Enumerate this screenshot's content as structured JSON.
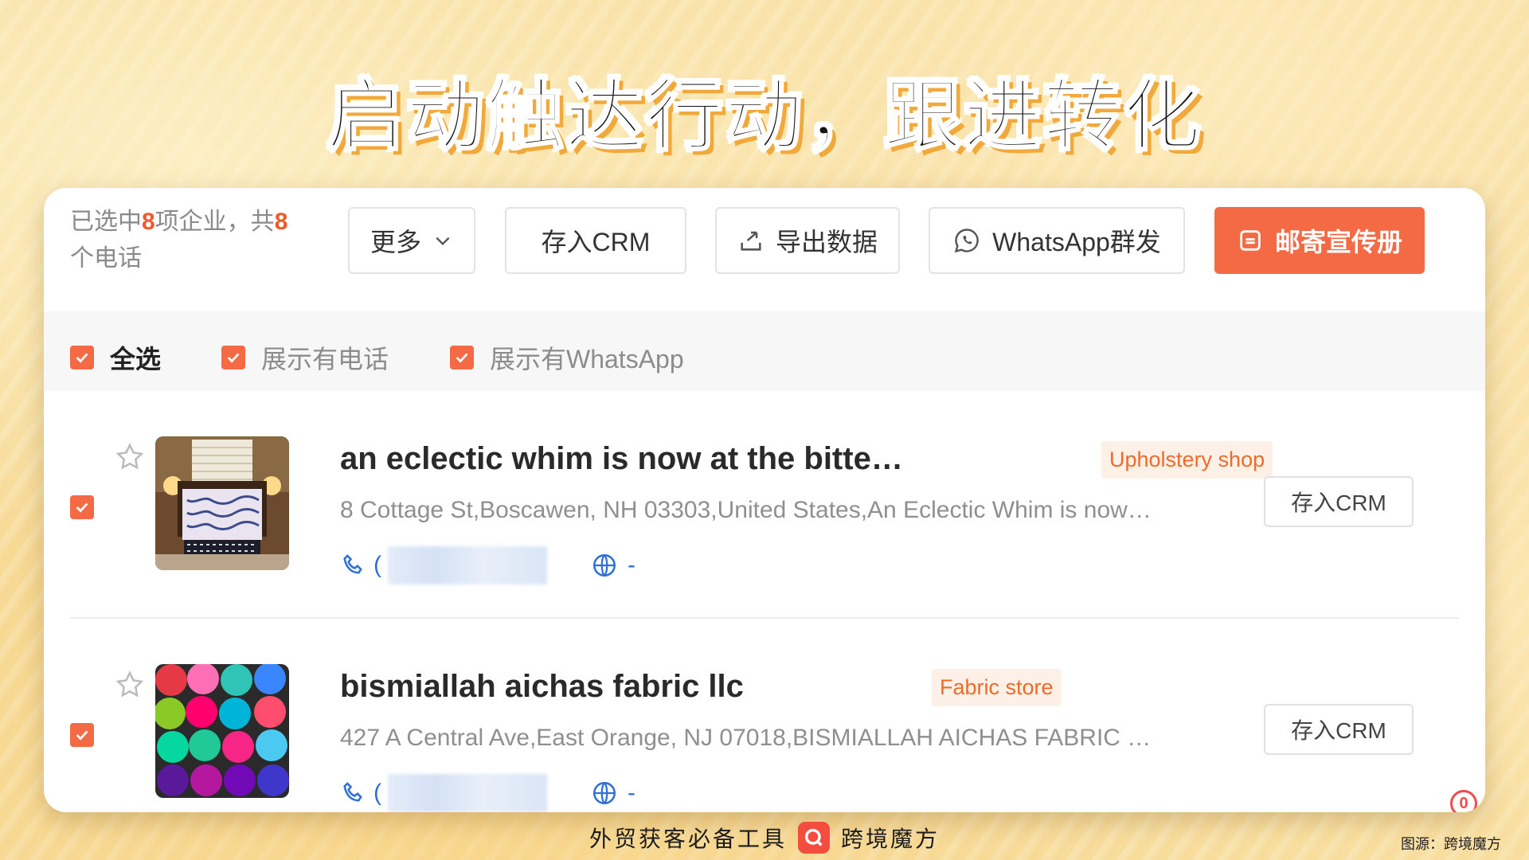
{
  "headline": "启动触达行动，跟进转化",
  "toolbar": {
    "selection_prefix": "已选中",
    "selected_count": "8",
    "selection_mid": "项企业，共",
    "phone_count": "8",
    "selection_suffix": "个电话",
    "more_label": "更多",
    "save_crm_label": "存入CRM",
    "export_label": "导出数据",
    "whatsapp_label": "WhatsApp群发",
    "mail_label": "邮寄宣传册"
  },
  "filters": {
    "select_all": "全选",
    "show_phone": "展示有电话",
    "show_whatsapp": "展示有WhatsApp"
  },
  "results": [
    {
      "name": "an eclectic whim is now at the bitte…",
      "tag": "Upholstery shop",
      "address": "8 Cottage St,Boscawen, NH 03303,United States,An Eclectic Whim is now…",
      "phone_prefix": "(",
      "website": "-",
      "crm_label": "存入CRM"
    },
    {
      "name": "bismiallah aichas fabric llc",
      "tag": "Fabric store",
      "address": "427 A Central Ave,East Orange, NJ 07018,BISMIALLAH AICHAS FABRIC …",
      "phone_prefix": "(",
      "website": "-",
      "crm_label": "存入CRM"
    }
  ],
  "notification_count": "0",
  "footer": {
    "slogan": "外贸获客必备工具",
    "brand": "跨境魔方",
    "source": "图源：跨境魔方"
  },
  "colors": {
    "accent": "#f46a45",
    "link_blue": "#2f6fd6"
  }
}
